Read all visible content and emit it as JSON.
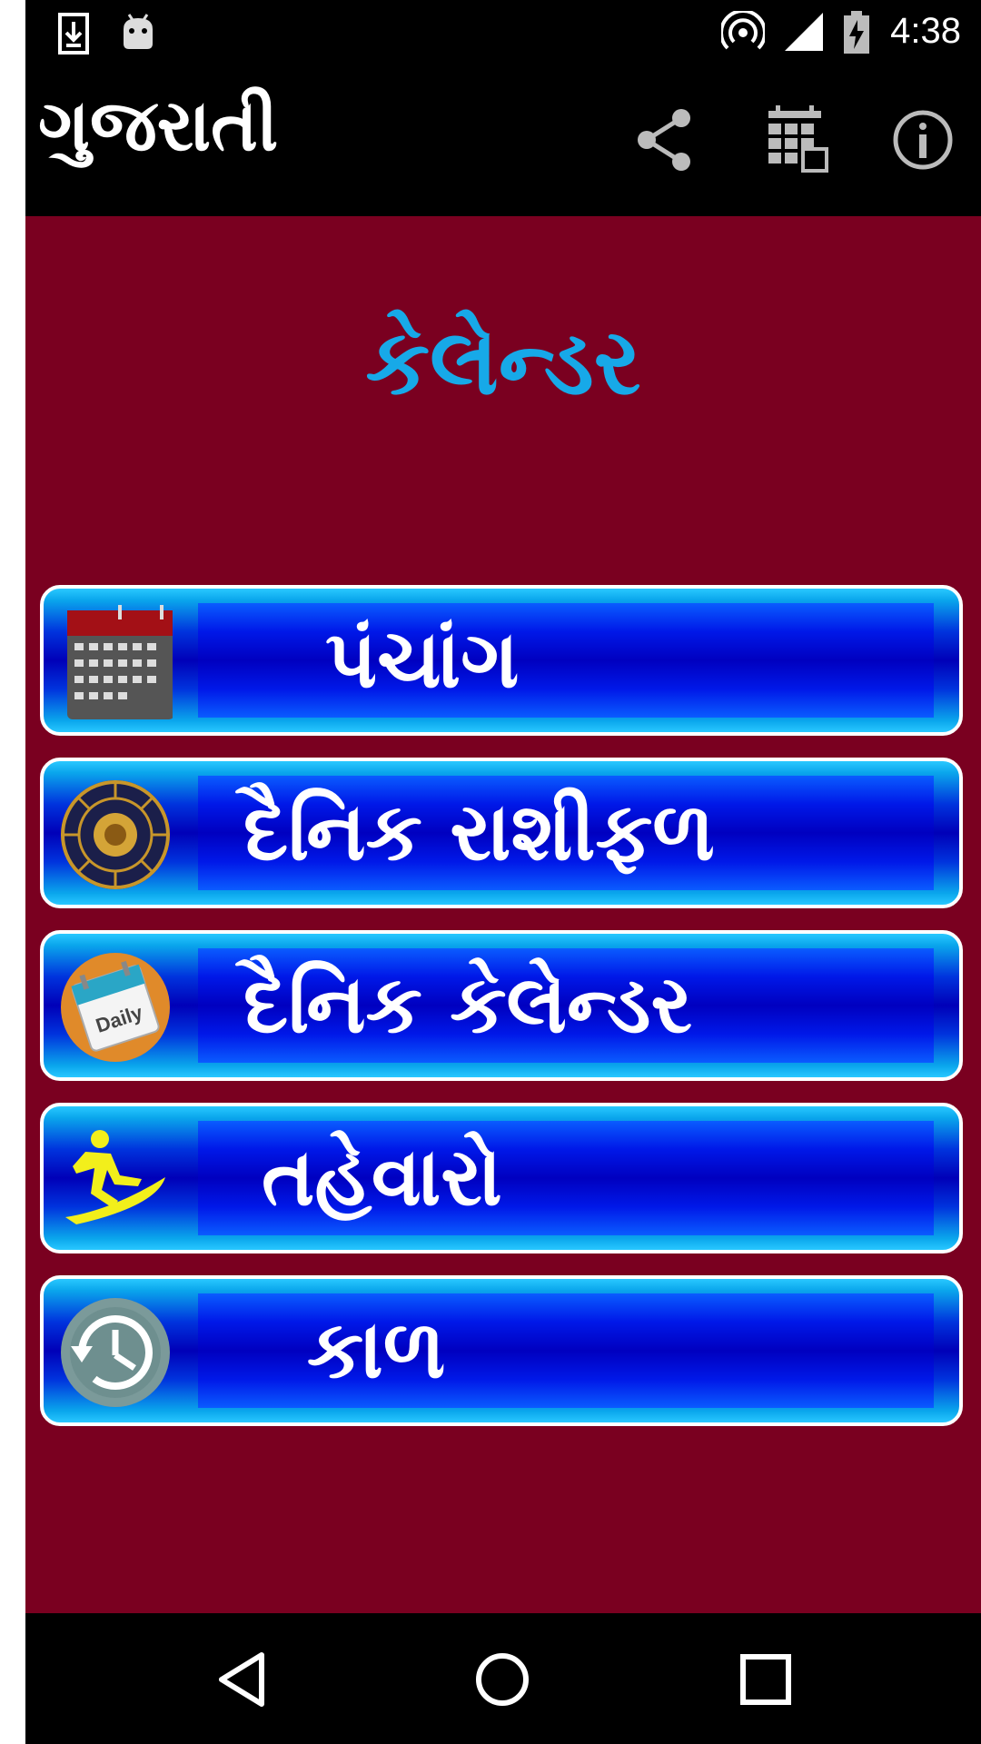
{
  "status_bar": {
    "time": "4:38",
    "icons": [
      "download-icon",
      "android-icon",
      "hotspot-icon",
      "signal-icon",
      "battery-charging-icon"
    ]
  },
  "app_bar": {
    "title": "ગુજરાતી",
    "actions": [
      "share-icon",
      "calendar-grid-icon",
      "info-icon"
    ]
  },
  "heading": "કેલેન્ડર",
  "menu": [
    {
      "label": "પંચાંગ",
      "icon": "calendar-icon"
    },
    {
      "label": "દૈનિક  રાશીફળ",
      "icon": "zodiac-wheel-icon"
    },
    {
      "label": "દૈનિક કેલેન્ડર",
      "icon": "daily-calendar-icon"
    },
    {
      "label": "તહેવારો",
      "icon": "festival-surfer-icon"
    },
    {
      "label": "કાળ",
      "icon": "clock-history-icon"
    }
  ],
  "nav_bar": [
    "back-icon",
    "home-icon",
    "recents-icon"
  ],
  "colors": {
    "background": "#7a0020",
    "heading": "#17a9e8",
    "bar": "#000000",
    "button_blue": "#0000c0"
  }
}
